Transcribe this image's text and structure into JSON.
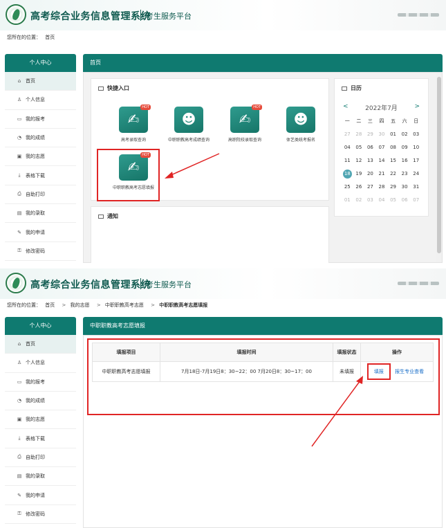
{
  "header": {
    "system_title": "高考综合业务信息管理系统",
    "subtitle": "考生服务平台"
  },
  "breadcrumb_home": {
    "prefix": "您所在的位置：",
    "items": [
      "首页"
    ]
  },
  "breadcrumb_fill": {
    "prefix": "您所在的位置：",
    "items": [
      "首页",
      "我的志愿",
      "中职职教高考志愿",
      "中职职教高考志愿填报"
    ],
    "separator": ">"
  },
  "sidebar": {
    "title": "个人中心",
    "items": [
      {
        "label": "首页",
        "icon": "home-icon"
      },
      {
        "label": "个人信息",
        "icon": "user-icon"
      },
      {
        "label": "我的报考",
        "icon": "register-icon"
      },
      {
        "label": "我的成绩",
        "icon": "score-icon"
      },
      {
        "label": "我的志愿",
        "icon": "wish-icon"
      },
      {
        "label": "表格下载",
        "icon": "download-icon"
      },
      {
        "label": "自助打印",
        "icon": "print-icon"
      },
      {
        "label": "我的录取",
        "icon": "admission-icon"
      },
      {
        "label": "我的申请",
        "icon": "apply-icon"
      },
      {
        "label": "修改密码",
        "icon": "lock-icon"
      }
    ]
  },
  "home": {
    "main_title": "首页",
    "quick_title": "快捷入口",
    "quick_items": [
      {
        "label": "高考录取查询",
        "hot": true,
        "icon": "edit-doc-icon"
      },
      {
        "label": "中职职教高考成绩查询",
        "hot": false,
        "icon": "users-icon"
      },
      {
        "label": "高职院校录取查询",
        "hot": true,
        "icon": "edit-doc-icon"
      },
      {
        "label": "体艺类统考报名",
        "hot": false,
        "icon": "users-icon"
      },
      {
        "label": "中职职教高考志愿填报",
        "hot": true,
        "icon": "edit-doc-icon"
      }
    ],
    "hot_label": "HOT",
    "notice_title": "通知",
    "calendar": {
      "title": "日历",
      "month": "2022年7月",
      "prev": "<",
      "next": ">",
      "weekdays": [
        "一",
        "二",
        "三",
        "四",
        "五",
        "六",
        "日"
      ],
      "days": [
        {
          "d": "27",
          "dim": true
        },
        {
          "d": "28",
          "dim": true
        },
        {
          "d": "29",
          "dim": true
        },
        {
          "d": "30",
          "dim": true
        },
        {
          "d": "01"
        },
        {
          "d": "02"
        },
        {
          "d": "03"
        },
        {
          "d": "04"
        },
        {
          "d": "05"
        },
        {
          "d": "06"
        },
        {
          "d": "07"
        },
        {
          "d": "08"
        },
        {
          "d": "09"
        },
        {
          "d": "10"
        },
        {
          "d": "11"
        },
        {
          "d": "12"
        },
        {
          "d": "13"
        },
        {
          "d": "14"
        },
        {
          "d": "15"
        },
        {
          "d": "16"
        },
        {
          "d": "17"
        },
        {
          "d": "18",
          "today": true
        },
        {
          "d": "19"
        },
        {
          "d": "20"
        },
        {
          "d": "21"
        },
        {
          "d": "22"
        },
        {
          "d": "23"
        },
        {
          "d": "24"
        },
        {
          "d": "25"
        },
        {
          "d": "26"
        },
        {
          "d": "27"
        },
        {
          "d": "28"
        },
        {
          "d": "29"
        },
        {
          "d": "30"
        },
        {
          "d": "31"
        },
        {
          "d": "01",
          "dim": true
        },
        {
          "d": "02",
          "dim": true
        },
        {
          "d": "03",
          "dim": true
        },
        {
          "d": "04",
          "dim": true
        },
        {
          "d": "05",
          "dim": true
        },
        {
          "d": "06",
          "dim": true
        },
        {
          "d": "07",
          "dim": true
        }
      ]
    }
  },
  "fill": {
    "main_title": "中职职教高考志愿填报",
    "columns": [
      "填报项目",
      "填报时间",
      "填报状态",
      "操作"
    ],
    "row": {
      "item": "中职职教高考志愿填报",
      "time": "7月18日-7月19日8：30~22：00 7月20日8：30~17：00",
      "status": "未填报",
      "op_fill": "填报",
      "op_view": "报生专业查看"
    }
  },
  "colors": {
    "teal": "#0f7a70",
    "title_green": "#0f5a4f",
    "annotation_red": "#e02424",
    "link_blue": "#1a6fc9"
  }
}
